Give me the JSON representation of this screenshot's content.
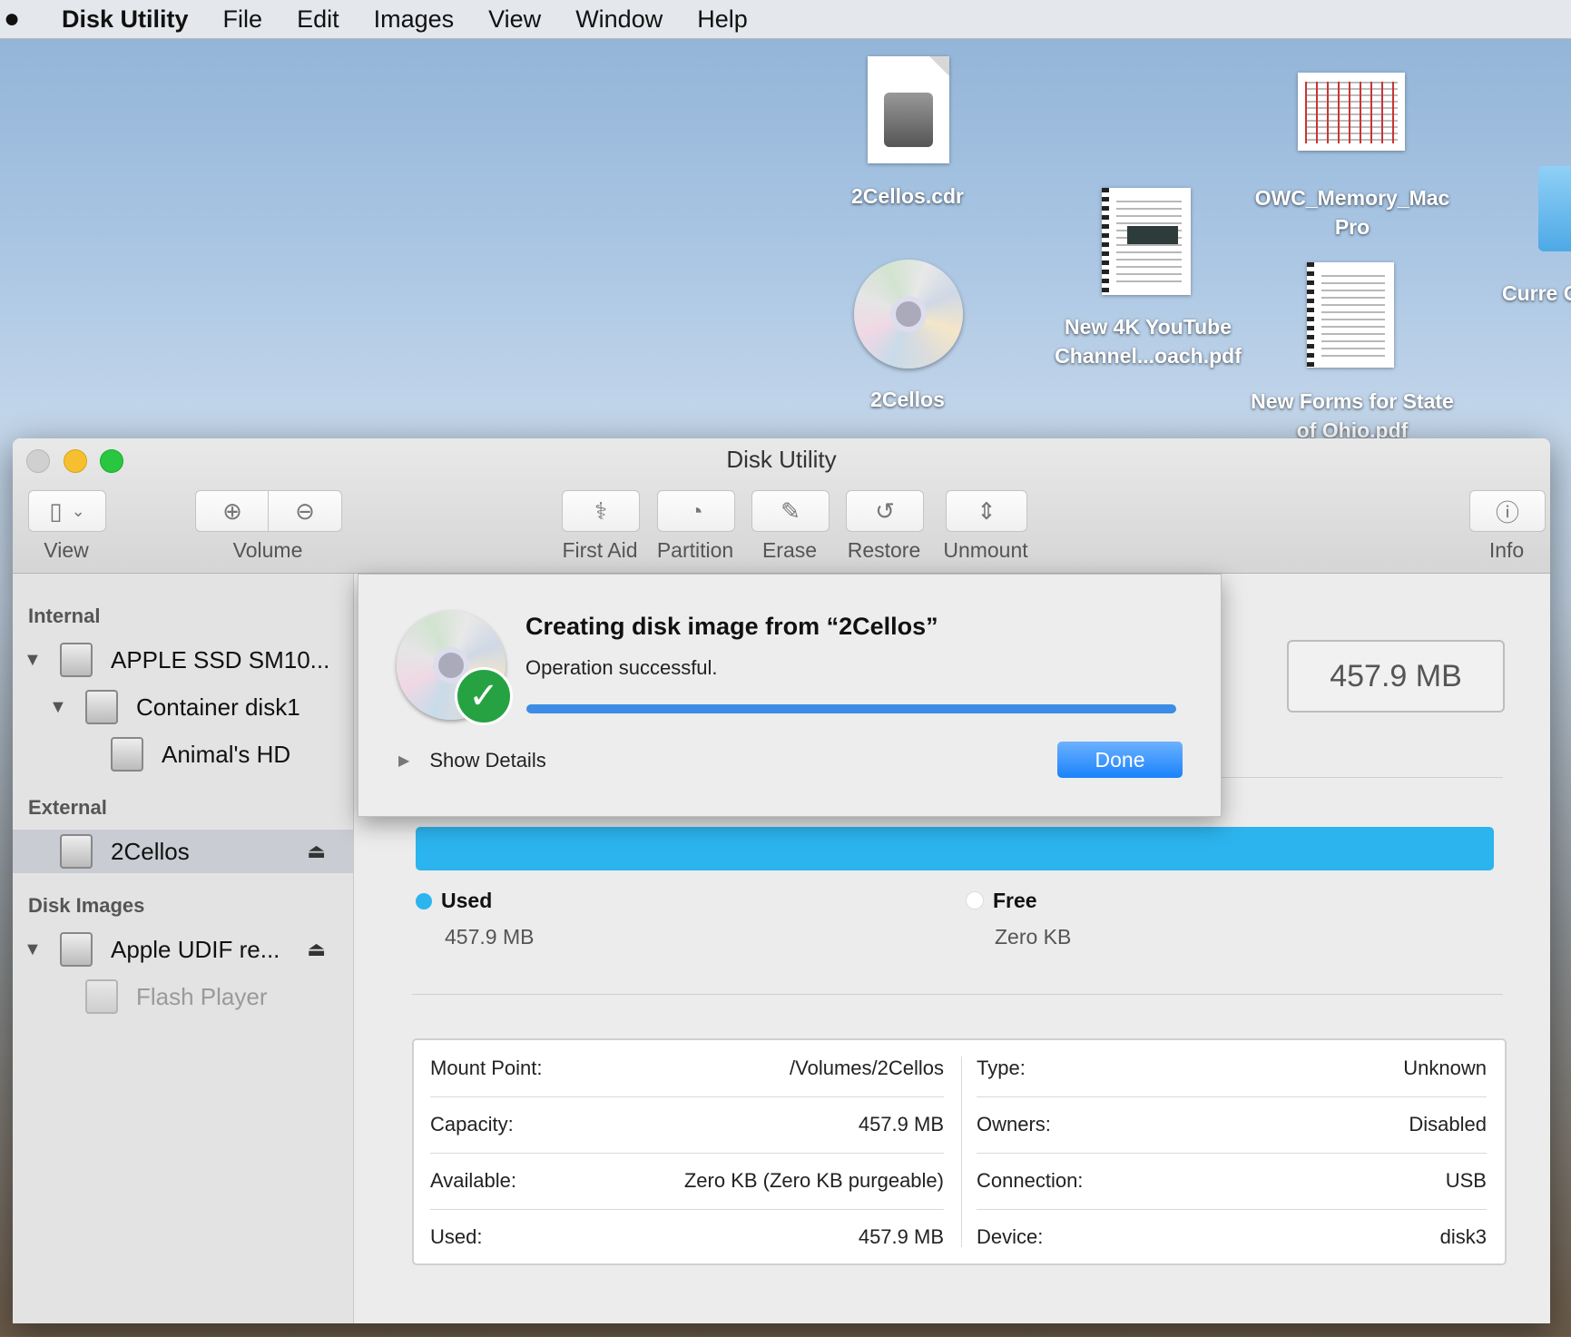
{
  "menubar": {
    "apple": "",
    "app": "Disk Utility",
    "items": [
      "File",
      "Edit",
      "Images",
      "View",
      "Window",
      "Help"
    ]
  },
  "desktop": {
    "icons": [
      {
        "label": "2Cellos.cdr"
      },
      {
        "label": "2Cellos"
      },
      {
        "label": "New 4K YouTube Channel...oach.pdf"
      },
      {
        "label": "OWC_Memory_Mac Pro"
      },
      {
        "label": "New Forms for State of Ohio.pdf"
      },
      {
        "label": "Curre O"
      }
    ]
  },
  "window": {
    "title": "Disk Utility",
    "toolbar": {
      "view": "View",
      "volume": "Volume",
      "first_aid": "First Aid",
      "partition": "Partition",
      "erase": "Erase",
      "restore": "Restore",
      "unmount": "Unmount",
      "info": "Info"
    }
  },
  "sidebar": {
    "internal_header": "Internal",
    "internal": [
      {
        "label": "APPLE SSD SM10..."
      },
      {
        "label": "Container disk1"
      },
      {
        "label": "Animal's HD"
      }
    ],
    "external_header": "External",
    "external": [
      {
        "label": "2Cellos"
      }
    ],
    "images_header": "Disk Images",
    "images": [
      {
        "label": "Apple UDIF re..."
      },
      {
        "label": "Flash Player"
      }
    ]
  },
  "main": {
    "capacity": "457.9 MB",
    "used_label": "Used",
    "used_value": "457.9 MB",
    "free_label": "Free",
    "free_value": "Zero KB",
    "used_fraction": 1.0,
    "info": {
      "left": [
        {
          "k": "Mount Point:",
          "v": "/Volumes/2Cellos"
        },
        {
          "k": "Capacity:",
          "v": "457.9 MB"
        },
        {
          "k": "Available:",
          "v": "Zero KB (Zero KB purgeable)"
        },
        {
          "k": "Used:",
          "v": "457.9 MB"
        }
      ],
      "right": [
        {
          "k": "Type:",
          "v": "Unknown"
        },
        {
          "k": "Owners:",
          "v": "Disabled"
        },
        {
          "k": "Connection:",
          "v": "USB"
        },
        {
          "k": "Device:",
          "v": "disk3"
        }
      ]
    }
  },
  "sheet": {
    "title": "Creating disk image from “2Cellos”",
    "status": "Operation successful.",
    "progress": 1.0,
    "show_details": "Show Details",
    "done": "Done"
  },
  "colors": {
    "used": "#2cb4ee",
    "progress": "#3c8ce6",
    "done_button": "#1a82fb",
    "check": "#27a243"
  }
}
